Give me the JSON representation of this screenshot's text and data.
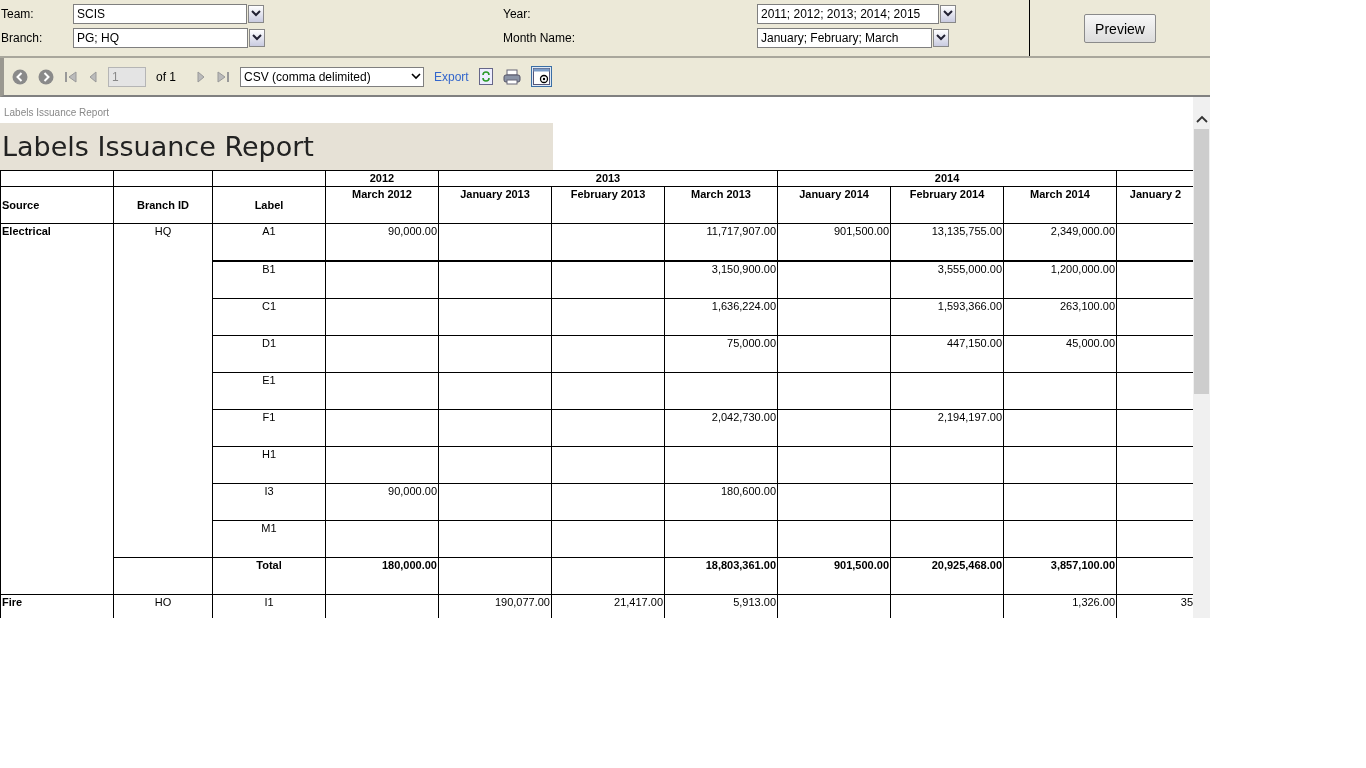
{
  "parameters": [
    {
      "label": "Team:",
      "value": "SCIS"
    },
    {
      "label": "Branch:",
      "value": "PG; HQ"
    },
    {
      "label": "Year:",
      "value": "2011; 2012; 2013; 2014; 2015"
    },
    {
      "label": "Month Name:",
      "value": "January; February; March"
    }
  ],
  "preview_button": "Preview",
  "toolbar": {
    "page": "1",
    "page_of": "of 1",
    "format": "CSV (comma delimited)",
    "export": "Export"
  },
  "report": {
    "breadcrumb": "Labels Issuance Report",
    "title": "Labels Issuance Report",
    "columns": [
      "Source",
      "Branch ID",
      "Label"
    ],
    "years": [
      {
        "label": "2012",
        "months": [
          "March 2012"
        ]
      },
      {
        "label": "2013",
        "months": [
          "January 2013",
          "February 2013",
          "March 2013"
        ]
      },
      {
        "label": "2014",
        "months": [
          "January 2014",
          "February 2014",
          "March 2014"
        ]
      },
      {
        "months": [
          "January 2"
        ]
      }
    ],
    "groups": [
      {
        "source": "Electrical",
        "branch": "HQ",
        "rows": [
          {
            "label": "A1",
            "values": {
              "March 2012": "90,000.00",
              "March 2013": "11,717,907.00",
              "January 2014": "901,500.00",
              "February 2014": "13,135,755.00",
              "March 2014": "2,349,000.00"
            }
          },
          {
            "label": "B1",
            "values": {
              "March 2013": "3,150,900.00",
              "February 2014": "3,555,000.00",
              "March 2014": "1,200,000.00"
            }
          },
          {
            "label": "C1",
            "values": {
              "March 2013": "1,636,224.00",
              "February 2014": "1,593,366.00",
              "March 2014": "263,100.00"
            }
          },
          {
            "label": "D1",
            "values": {
              "March 2013": "75,000.00",
              "February 2014": "447,150.00",
              "March 2014": "45,000.00"
            }
          },
          {
            "label": "E1"
          },
          {
            "label": "F1",
            "values": {
              "March 2013": "2,042,730.00",
              "February 2014": "2,194,197.00"
            }
          },
          {
            "label": "H1"
          },
          {
            "label": "I3",
            "values": {
              "March 2012": "90,000.00",
              "March 2013": "180,600.00"
            }
          },
          {
            "label": "M1"
          }
        ],
        "total": {
          "label": "Total",
          "values": {
            "March 2012": "180,000.00",
            "March 2013": "18,803,361.00",
            "January 2014": "901,500.00",
            "February 2014": "20,925,468.00",
            "March 2014": "3,857,100.00"
          }
        }
      },
      {
        "source": "Fire",
        "branch": "HO",
        "rows": [
          {
            "label": "I1",
            "values": {
              "January 2013": "190,077.00",
              "February 2013": "21,417.00",
              "March 2013": "5,913.00",
              "March 2014": "1,326.00",
              "January 2": "35"
            }
          }
        ]
      }
    ]
  }
}
